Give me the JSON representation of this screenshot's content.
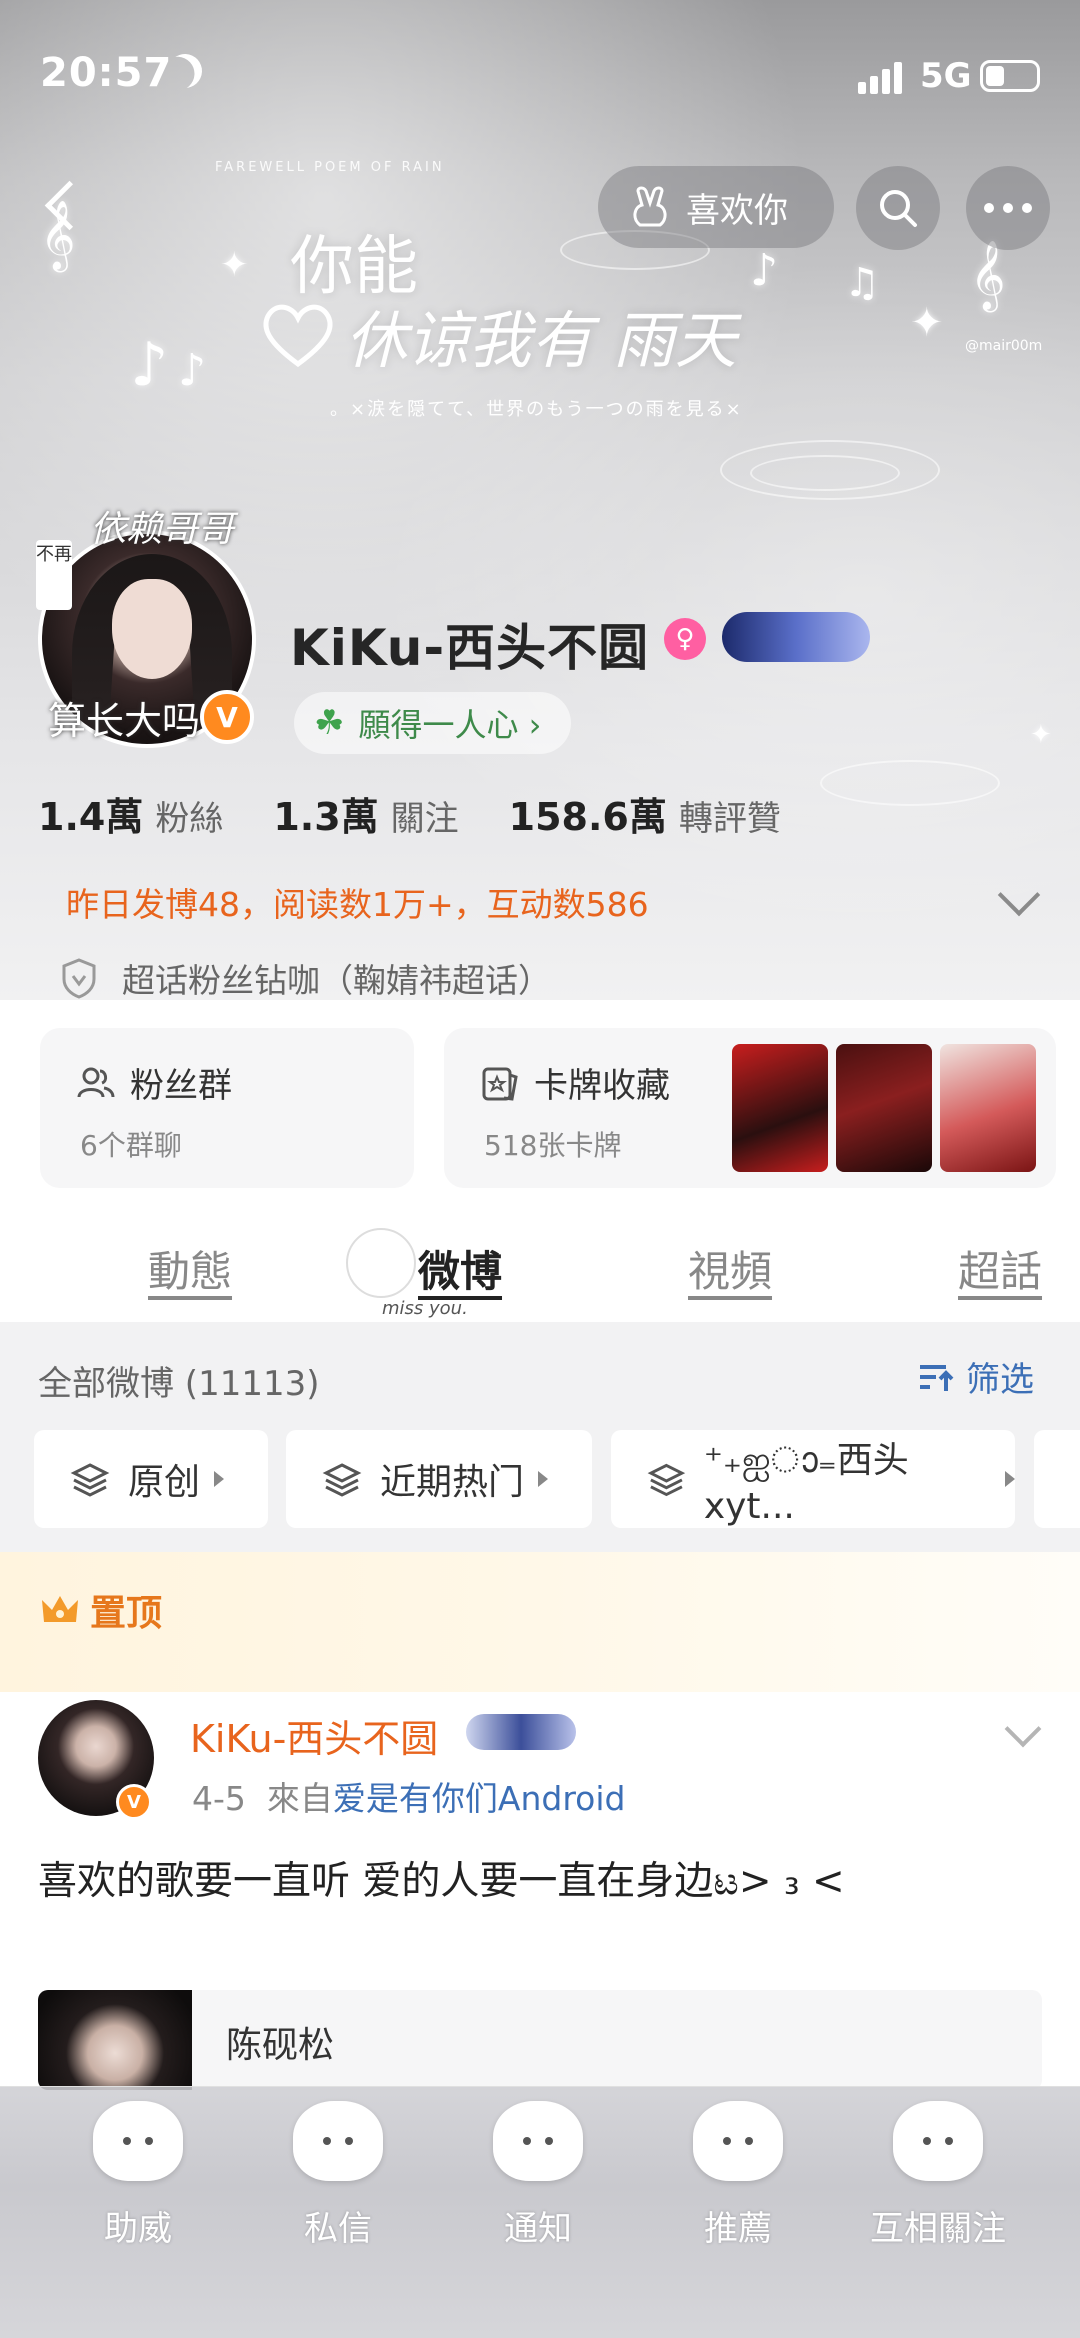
{
  "status_bar": {
    "time": "20:57",
    "network": "5G"
  },
  "banner": {
    "line1": "你能",
    "line2": "休谅我有 雨天",
    "subline": "。×涙を隠てて、世界のもう一つの雨を見る×",
    "watermark": "FAREWELL POEM OF RAIN",
    "credit": "@mair00m"
  },
  "header_actions": {
    "like_label": "喜欢你"
  },
  "profile": {
    "avatar_top_text": "依赖哥哥",
    "avatar_side_text": "不再",
    "avatar_bottom_text": "算长大吗",
    "verified_mark": "V",
    "username": "KiKu-西头不圆",
    "gender_symbol": "♀",
    "motto": "願得一人心 ›",
    "stats": [
      {
        "value": "1.4萬",
        "label": "粉絲"
      },
      {
        "value": "1.3萬",
        "label": "關注"
      },
      {
        "value": "158.6萬",
        "label": "轉評贊"
      }
    ],
    "daily_summary": "昨日发博48，阅读数1万+，互动数586",
    "super_topic": "超话粉丝钻咖（鞠婧祎超话）"
  },
  "cards": {
    "fans_group": {
      "title": "粉丝群",
      "subtitle": "6个群聊"
    },
    "card_collection": {
      "title": "卡牌收藏",
      "subtitle": "518张卡牌"
    }
  },
  "tabs": [
    {
      "label": "動態"
    },
    {
      "label": "微博"
    },
    {
      "label": "視頻"
    },
    {
      "label": "超話"
    }
  ],
  "tab_mascot_text": "miss you.",
  "feed": {
    "all_label": "全部微博 (11113)",
    "filter_label": "筛选",
    "chips": [
      {
        "label": "原创"
      },
      {
        "label": "近期热门"
      },
      {
        "label": "⁺₊ஐാ₌西头xyt..."
      }
    ]
  },
  "pinned": {
    "label": "置顶",
    "post": {
      "author": "KiKu-西头不圆",
      "date": "4-5",
      "source_prefix": "來自",
      "source": "爱是有你们Android",
      "text": "喜欢的歌要一直听 爱的人要一直在身边ಟ> ₃ <",
      "repost_author": "陈砚松"
    }
  },
  "bottom_nav": [
    {
      "label": "助威"
    },
    {
      "label": "私信"
    },
    {
      "label": "通知"
    },
    {
      "label": "推薦"
    },
    {
      "label": "互相關注"
    }
  ],
  "colors": {
    "accent_orange": "#e8641d",
    "link_blue": "#3c6fb6",
    "verified_orange": "#ff8a1f",
    "gender_pink": "#ff5fa2"
  }
}
